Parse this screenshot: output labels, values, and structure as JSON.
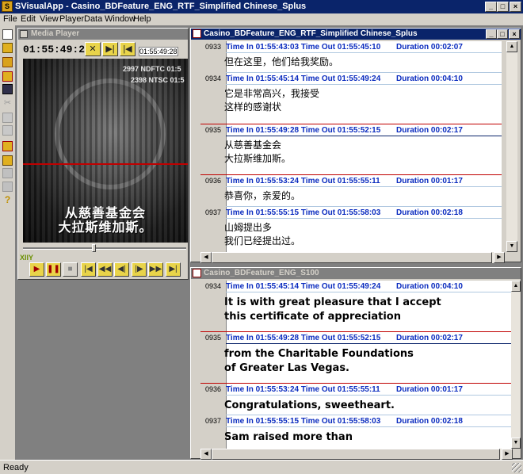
{
  "window": {
    "title": "SVisualApp - Casino_BDFeature_ENG_RTF_Simplified Chinese_Splus",
    "min": "_",
    "max": "□",
    "close": "×"
  },
  "menu": [
    {
      "label": "File"
    },
    {
      "label": "Edit"
    },
    {
      "label": "View"
    },
    {
      "label": "Player"
    },
    {
      "label": "Data"
    },
    {
      "label": "Window"
    },
    {
      "label": "Help"
    }
  ],
  "player": {
    "title": "Media Player",
    "timecode": "01:55:49:27",
    "small_timecode": "01:55:49:28",
    "overlay_line1": "2997 NDFTC 01:5",
    "overlay_line2": "2398 NTSC 01:5",
    "subtitle_line1": "从慈善基金会",
    "subtitle_line2": "大拉斯维加斯。",
    "label": "XIIY"
  },
  "chinese_window": {
    "title": "Casino_BDFeature_ENG_RTF_Simplified Chinese_Splus",
    "entries": [
      {
        "num": "0933",
        "tin": "Time In 01:55:43:03",
        "tout": "Time Out 01:55:45:10",
        "dur": "Duration 00:02:07",
        "lines": [
          "但在这里，他们给我奖励。"
        ]
      },
      {
        "num": "0934",
        "tin": "Time In 01:55:45:14",
        "tout": "Time Out 01:55:49:24",
        "dur": "Duration 00:04:10",
        "lines": [
          "它是非常高兴，我接受",
          "这样的感谢状"
        ]
      },
      {
        "num": "0935",
        "tin": "Time In 01:55:49:28",
        "tout": "Time Out 01:55:52:15",
        "dur": "Duration 00:02:17",
        "lines": [
          "从慈善基金会",
          "大拉斯维加斯。"
        ]
      },
      {
        "num": "0936",
        "tin": "Time In 01:55:53:24",
        "tout": "Time Out 01:55:55:11",
        "dur": "Duration 00:01:17",
        "lines": [
          "恭喜你，亲爱的。"
        ]
      },
      {
        "num": "0937",
        "tin": "Time In 01:55:55:15",
        "tout": "Time Out 01:55:58:03",
        "dur": "Duration 00:02:18",
        "lines": [
          "山姆提出多",
          "我们已经提出过。"
        ]
      }
    ]
  },
  "english_window": {
    "title": "Casino_BDFeature_ENG_S100",
    "entries": [
      {
        "num": "0934",
        "tin": "Time In 01:55:45:14",
        "tout": "Time Out 01:55:49:24",
        "dur": "Duration 00:04:10",
        "lines": [
          "It is with great pleasure that I accept",
          "this certificate of appreciation"
        ]
      },
      {
        "num": "0935",
        "tin": "Time In 01:55:49:28",
        "tout": "Time Out 01:55:52:15",
        "dur": "Duration 00:02:17",
        "lines": [
          "from the Charitable Foundations",
          "of Greater Las Vegas."
        ]
      },
      {
        "num": "0936",
        "tin": "Time In 01:55:53:24",
        "tout": "Time Out 01:55:55:11",
        "dur": "Duration 00:01:17",
        "lines": [
          "Congratulations, sweetheart."
        ]
      },
      {
        "num": "0937",
        "tin": "Time In 01:55:55:15",
        "tout": "Time Out 01:55:58:03",
        "dur": "Duration 00:02:18",
        "lines": [
          "Sam raised more than",
          ""
        ]
      }
    ]
  },
  "status": {
    "text": "Ready"
  },
  "colors": {
    "title_active": "#0a246a",
    "timecode_blue": "#0a2bbf",
    "selection_red": "#c00000",
    "button_yellow": "#e9d44a"
  },
  "icons": [
    "new-file-icon",
    "open-folder-icon",
    "save-icon",
    "cut-icon",
    "copy-icon",
    "paste-icon",
    "print-icon",
    "help-icon"
  ]
}
